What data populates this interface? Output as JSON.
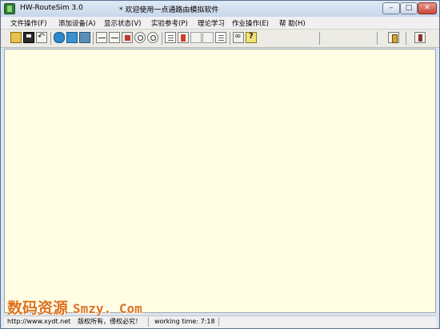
{
  "window": {
    "title": "HW-RouteSim 3.0",
    "subtitle": "* 欢迎使用一点通路由模拟软件",
    "buttons": {
      "minimize": "–",
      "maximize": "□",
      "close": "✕"
    }
  },
  "menu": [
    "文件操作(F)",
    "添加设备(A)",
    "显示状态(V)",
    "实验参考(P)",
    "理论学习",
    "作业操作(E)",
    "帮 助(H)"
  ],
  "toolbar": {
    "icons": [
      "open-folder-icon",
      "save-icon",
      "undo-icon",
      "router-icon",
      "switch-icon",
      "pc-icon",
      "link-icon",
      "port-icon",
      "delete-icon",
      "zoom-in-icon",
      "zoom-out-icon",
      "doc-icon",
      "pdf-icon",
      "blank1-icon",
      "blank2-icon",
      "notes-icon",
      "glasses-icon",
      "help-icon",
      "exit-icon",
      "person-icon"
    ]
  },
  "status": {
    "url": "http://www.xydt.net",
    "copyright": "版权所有，侵权必究！",
    "working_time": "working time: 7:18"
  },
  "watermark": {
    "cn": "数码资源",
    "en": "Smzy. Com"
  },
  "colors": {
    "canvas": "#fffde3",
    "watermark": "#e0731a",
    "titlebar": "#c7d7ea"
  }
}
